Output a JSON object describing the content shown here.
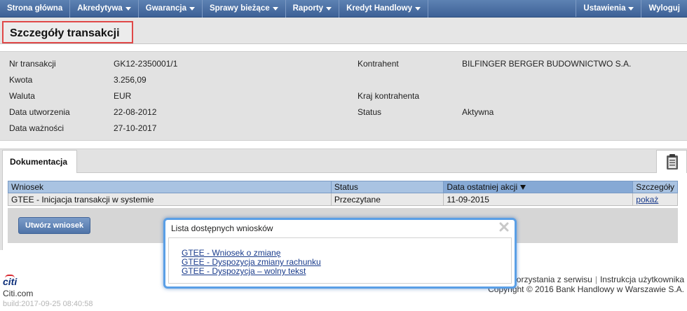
{
  "nav": {
    "items": [
      {
        "label": "Strona główna",
        "caret": false
      },
      {
        "label": "Akredytywa",
        "caret": true
      },
      {
        "label": "Gwarancja",
        "caret": true
      },
      {
        "label": "Sprawy bieżące",
        "caret": true
      },
      {
        "label": "Raporty",
        "caret": true
      },
      {
        "label": "Kredyt Handlowy",
        "caret": true
      }
    ],
    "right_items": [
      {
        "label": "Ustawienia",
        "caret": true
      },
      {
        "label": "Wyloguj",
        "caret": false
      }
    ]
  },
  "page_title": "Szczegóły transakcji",
  "details": {
    "left": [
      {
        "label": "Nr transakcji",
        "value": "GK12-2350001/1"
      },
      {
        "label": "Kwota",
        "value": "3.256,09"
      },
      {
        "label": "Waluta",
        "value": "EUR"
      },
      {
        "label": "Data utworzenia",
        "value": "22-08-2012"
      },
      {
        "label": "Data ważności",
        "value": "27-10-2017"
      }
    ],
    "right": [
      {
        "label": "Kontrahent",
        "value": "BILFINGER BERGER BUDOWNICTWO S.A."
      },
      {
        "label": "Kraj kontrahenta",
        "value": ""
      },
      {
        "label": "Status",
        "value": "Aktywna"
      }
    ]
  },
  "documentation": {
    "tab_label": "Dokumentacja",
    "columns": [
      "Wniosek",
      "Status",
      "Data ostatniej akcji",
      "Szczegóły"
    ],
    "rows": [
      {
        "wniosek": "GTEE - Inicjacja transakcji w systemie",
        "status": "Przeczytane",
        "data": "11-09-2015",
        "link": "pokaż"
      }
    ],
    "create_button": "Utwórz wniosek"
  },
  "popup": {
    "title": "Lista dostępnych wniosków",
    "links": [
      "GTEE - Wniosek o zmianę",
      "GTEE - Dyspozycja zmiany rachunku",
      "GTEE - Dyspozycja – wolny tekst"
    ]
  },
  "footer": {
    "logo": "citi",
    "site": "Citi.com",
    "build": "build:2017-09-25 08:40:58",
    "link_terms": "korzystania z serwisu",
    "link_manual": "Instrukcja użytkownika",
    "separator": "|",
    "copyright": "Copyright © 2016 Bank Handlowy w Warszawie S.A."
  },
  "colors": {
    "nav": "#3d6196",
    "accent_link": "#1a3c8c",
    "title_highlight": "#e04848",
    "popup_border": "#5a9fe6"
  }
}
